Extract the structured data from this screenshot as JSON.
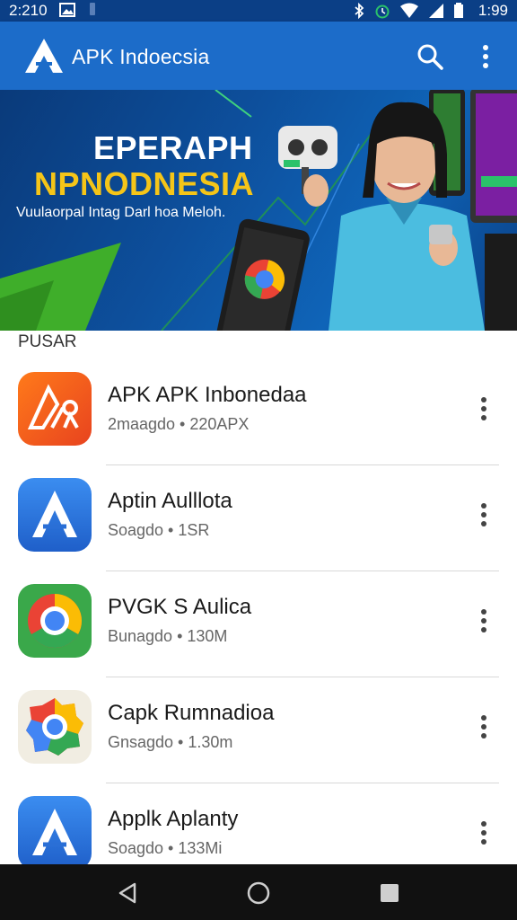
{
  "status_bar": {
    "time_left": "2:210",
    "time_right": "1:99",
    "icons": [
      "image-icon",
      "notification-icon",
      "bluetooth-icon",
      "alarm-icon",
      "wifi-icon",
      "signal-icon",
      "battery-icon"
    ]
  },
  "app_bar": {
    "title": "APK Indoecsia",
    "color": "#1c6cc9"
  },
  "banner": {
    "heading_line1": "EPERAPH",
    "heading_line2": "NPNODNESIA",
    "subtitle": "Vuulaorpal Intag Darl hoa Meloh."
  },
  "section": {
    "label": "PUSAR"
  },
  "apps": [
    {
      "name": "APK APK Inbonedaa",
      "meta": "2maagdo • 220APX",
      "icon": "apk-orange-icon"
    },
    {
      "name": "Aptin Aulllota",
      "meta": "Soagdo • 1SR",
      "icon": "apk-blue-icon"
    },
    {
      "name": "PVGK S Aulica",
      "meta": "Bunagdo • 130M",
      "icon": "chrome-icon"
    },
    {
      "name": "Capk Rumnadioa",
      "meta": "Gnsagdo • 1.30m",
      "icon": "gear-color-icon"
    },
    {
      "name": "Applk Aplanty",
      "meta": "Soagdo • 133Mi",
      "icon": "apk-blue-icon"
    }
  ],
  "nav_bar": {
    "buttons": [
      "back-icon",
      "home-icon",
      "recents-icon"
    ]
  }
}
